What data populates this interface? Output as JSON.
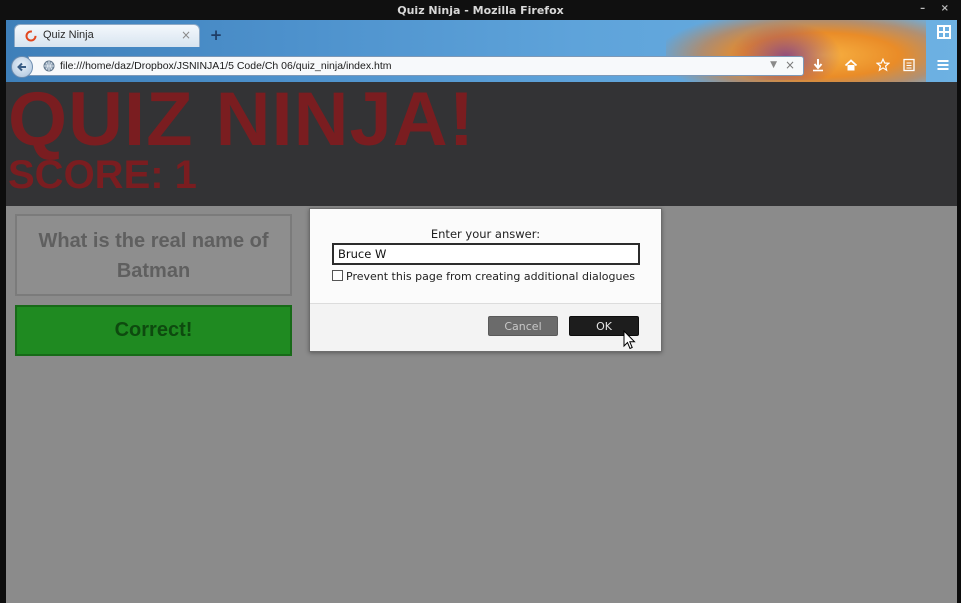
{
  "window": {
    "title": "Quiz Ninja - Mozilla Firefox",
    "controls": "– ×"
  },
  "browser": {
    "tab": {
      "label": "Quiz Ninja",
      "close": "×",
      "new_tab": "+"
    },
    "url": "file:///home/daz/Dropbox/JSNINJA1/5 Code/Ch 06/quiz_ninja/index.htm",
    "url_dropdown": "▼",
    "url_clear": "×",
    "icons": [
      "back-icon",
      "globe-icon",
      "download-icon",
      "home-icon",
      "bookmark-star-icon",
      "reading-list-icon",
      "menu-icon",
      "tab-groups-icon"
    ],
    "accent_color": "#4d91cc"
  },
  "page": {
    "header": {
      "title": "QUIZ NINJA!",
      "score": "SCORE: 1",
      "color": "#7a1d20"
    },
    "question": "What is the real name of Batman",
    "feedback": "Correct!",
    "feedback_color": "#1f8a21"
  },
  "dialog": {
    "message": "Enter your answer:",
    "input_value": "Bruce W",
    "checkbox_label": "Prevent this page from creating additional dialogues",
    "checkbox_checked": false,
    "cancel_label": "Cancel",
    "ok_label": "OK"
  }
}
